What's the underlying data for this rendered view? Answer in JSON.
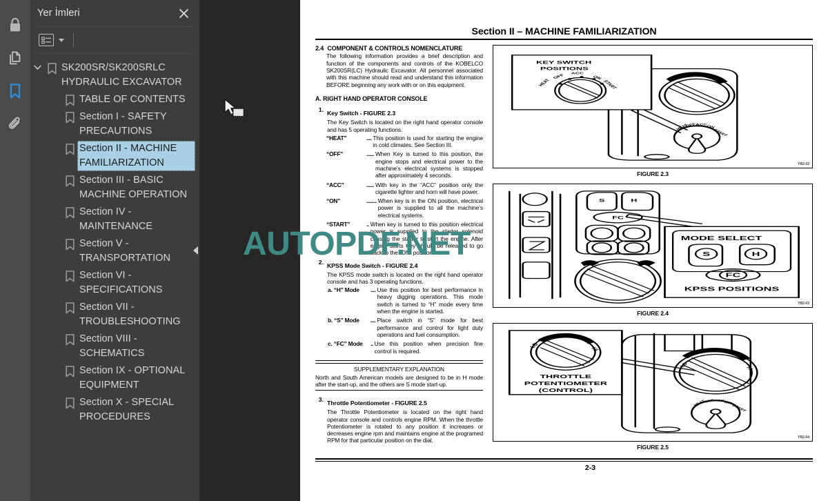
{
  "rail": {
    "items": [
      {
        "name": "lock-icon",
        "label": "Güvenlik"
      },
      {
        "name": "pages-icon",
        "label": "Sayfa Küçük Resimleri"
      },
      {
        "name": "bookmark-icon",
        "label": "Yer İmleri",
        "active": true
      },
      {
        "name": "attachment-icon",
        "label": "Ekler"
      }
    ]
  },
  "panel": {
    "title": "Yer İmleri",
    "close_label": "✕",
    "toolbar": {
      "options_icon": "list-options-icon",
      "caret_icon": "chevron-down-icon"
    },
    "tree": [
      {
        "label": "SK200SR/SK200SRLC HYDRAULIC EXCAVATOR",
        "level": 1,
        "expanded": true,
        "selected": false
      },
      {
        "label": "TABLE OF CONTENTS",
        "level": 2,
        "selected": false
      },
      {
        "label": "Section I - SAFETY PRECAUTIONS",
        "level": 2,
        "selected": false
      },
      {
        "label": "Section II - MACHINE FAMILIARIZATION",
        "level": 2,
        "selected": true
      },
      {
        "label": "Section III - BASIC MACHINE OPERATION",
        "level": 2,
        "selected": false
      },
      {
        "label": "Section IV - MAINTENANCE",
        "level": 2,
        "selected": false
      },
      {
        "label": "Section V - TRANSPORTATION",
        "level": 2,
        "selected": false
      },
      {
        "label": "Section VI - SPECIFICATIONS",
        "level": 2,
        "selected": false
      },
      {
        "label": "Section VII - TROUBLESHOOTING",
        "level": 2,
        "selected": false
      },
      {
        "label": "Section VIII - SCHEMATICS",
        "level": 2,
        "selected": false
      },
      {
        "label": "Section IX - OPTIONAL EQUIPMENT",
        "level": 2,
        "selected": false
      },
      {
        "label": "Section X - SPECIAL PROCEDURES",
        "level": 2,
        "selected": false
      }
    ]
  },
  "watermark": {
    "text": "AUTOPDF.NET",
    "color": "#3f8a86"
  },
  "document": {
    "title": "Section II – MACHINE FAMILIARIZATION",
    "page_number": "2-3",
    "section": {
      "number": "2.4",
      "heading": "COMPONENT & CONTROLS NOMENCLATURE",
      "intro": "The following information provides a brief description and function of the components and controls of the KOBELCO SK200SR(LC) Hydraulic Excavator. All personnel associated with this machine should read and understand this information BEFORE beginning any work with or on this equipment."
    },
    "block_a": "A. RIGHT HAND OPERATOR CONSOLE",
    "items": [
      {
        "n": "1.",
        "title": "Key Switch - FIGURE 2.3",
        "body": "The Key Switch is located on the right hand operator console and has 5 operating functions.",
        "defs": [
          {
            "term": "“HEAT”",
            "dots": "....",
            "def": "This position is used for starting the engine in cold climates. See Section III."
          },
          {
            "term": "“OFF”",
            "dots": "......",
            "def": "When Key is turned to this position, the engine stops and electrical power to the machine’s electrical systems is stopped after approximately 4 seconds."
          },
          {
            "term": "“ACC”",
            "dots": "......",
            "def": "With key in the “ACC” position only the cigarette lighter and horn will have power."
          },
          {
            "term": "“ON”",
            "dots": "........",
            "def": "When key is in the ON position, electrical power is supplied to all the machine’s electrical systems."
          },
          {
            "term": "“START”",
            "dots": "..",
            "def": "When key is turned to this position electrical power is supplied to the starter solenoid causing the starter to start the engine. After engine starts Key should be released to go back to the “ON” position."
          }
        ]
      },
      {
        "n": "2.",
        "title": "KPSS Mode Switch - FIGURE 2.4",
        "body": "The KPSS mode switch is located on the right hand operator console and has 3 operating functions.",
        "subs": [
          {
            "term": "a. “H” Mode",
            "dots": "....",
            "def": "Use this position for best performance in heavy digging operations. This mode switch is turned to “H” mode every time when the engine is started."
          },
          {
            "term": "b. “S” Mode",
            "dots": "....",
            "def": "Place switch in “S” mode for best performance and control for light duty operations and fuel consumption."
          },
          {
            "term": "c. “FC” Mode",
            "dots": "..",
            "def": "Use this position when precision fine control is required."
          }
        ]
      }
    ],
    "supplementary": {
      "title": "SUPPLEMENTARY EXPLANATION",
      "body": "North and South American models are designed to be in H mode after the start-up, and the others are S mode start-up."
    },
    "item3": {
      "n": "3.",
      "title": "Throttle Potentiometer - FIGURE 2.5",
      "body": "The Throttle Potentiometer is located on the right hand operator console and controls engine RPM. When the throttle Potentiometer is rotated to any position it increases or decreases engine rpm and maintains engine at the programed RPM for that particular position on the dial."
    },
    "figures": [
      {
        "caption": "FIGURE 2.3",
        "code": "YB2-02",
        "callout_line1": "KEY SWITCH",
        "callout_line2": "POSITIONS",
        "dial_labels": [
          "HEAT",
          "OFF",
          "ACC",
          "ON",
          "START"
        ]
      },
      {
        "caption": "FIGURE 2.4",
        "code": "YB2-03",
        "callout_line1": "MODE SELECT",
        "callout_line2": "KPSS POSITIONS",
        "buttons": [
          "S",
          "H",
          "FC"
        ]
      },
      {
        "caption": "FIGURE 2.5",
        "code": "YB2-04",
        "callout_line1": "THROTTLE",
        "callout_line2": "POTENTIOMETER",
        "callout_line3": "(CONTROL)",
        "dial_labels": [
          "LO",
          "HI"
        ]
      }
    ]
  }
}
